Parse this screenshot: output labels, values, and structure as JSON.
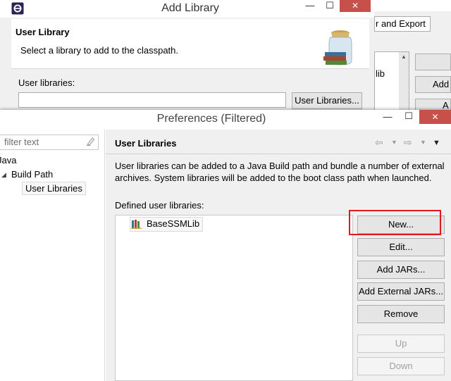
{
  "add_library": {
    "title": "Add Library",
    "banner_title": "User Library",
    "banner_desc": "Select a library to add to the classpath.",
    "label": "User libraries:",
    "button": "User Libraries..."
  },
  "background_dialog": {
    "tab_label": "r and Export",
    "list_fragment": "lib",
    "button_2_fragment": "Add",
    "button_3_fragment": "A"
  },
  "preferences": {
    "title": "Preferences (Filtered)",
    "filter_placeholder": "filter text",
    "tree": {
      "java": "Java",
      "build_path": "Build Path",
      "user_libraries": "User Libraries"
    },
    "page_title": "User Libraries",
    "description": "User libraries can be added to a Java Build path and bundle a number of external archives. System libraries will be added to the boot class path when launched.",
    "defined_label": "Defined user libraries:",
    "libraries": [
      "BaseSSMLib"
    ],
    "buttons": {
      "new": "New...",
      "edit": "Edit...",
      "add_jars": "Add JARs...",
      "add_external_jars": "Add External JARs...",
      "remove": "Remove",
      "up": "Up",
      "down": "Down"
    }
  },
  "window_controls": {
    "minimize": "—",
    "maximize": "☐",
    "close": "✕"
  },
  "colors": {
    "highlight": "#e0191f",
    "close_button": "#c7504b"
  }
}
